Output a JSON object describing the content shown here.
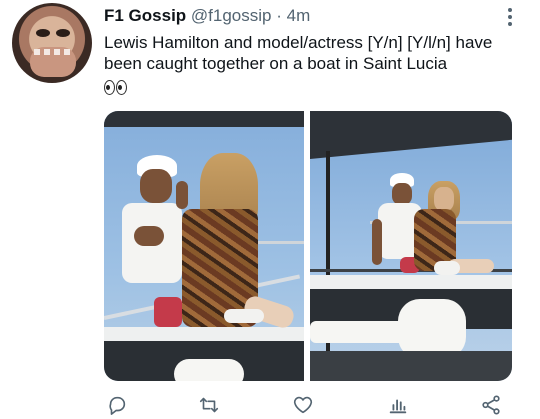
{
  "tweet": {
    "author_name": "F1 Gossip",
    "author_handle": "@f1gossip",
    "separator": "·",
    "time": "4m",
    "text": "Lewis Hamilton and model/actress [Y/n] [Y/l/n] have been caught together on a boat in Saint Lucia",
    "emoji": "eyes"
  },
  "media": {
    "count": 2,
    "photos": [
      "photo-1",
      "photo-2"
    ]
  },
  "actions": {
    "reply_icon": "reply-icon",
    "retweet_icon": "retweet-icon",
    "like_icon": "heart-icon",
    "analytics_icon": "analytics-icon",
    "share_icon": "share-icon"
  },
  "colors": {
    "text": "#0f1419",
    "secondary": "#536471",
    "icon": "#536471"
  }
}
